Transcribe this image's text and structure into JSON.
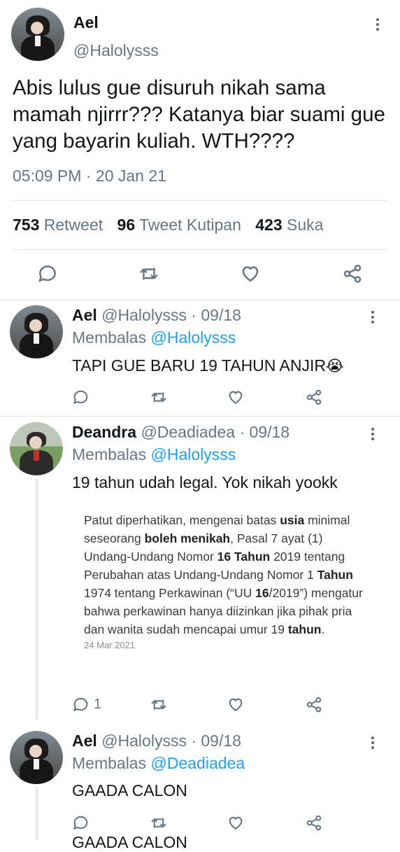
{
  "main_tweet": {
    "name": "Ael",
    "handle": "@Halolysss",
    "text": "Abis lulus gue disuruh nikah sama mamah njirrr??? Katanya biar suami gue yang bayarin kuliah. WTH????",
    "time": "05:09 PM",
    "dot": "·",
    "date": "20 Jan 21",
    "stats": {
      "retweets_count": "753",
      "retweets_label": "Retweet",
      "quotes_count": "96",
      "quotes_label": "Tweet Kutipan",
      "likes_count": "423",
      "likes_label": "Suka"
    }
  },
  "replies": [
    {
      "name": "Ael",
      "handle": "@Halolysss",
      "date": "· 09/18",
      "reply_prefix": "Membalas",
      "reply_to": "@Halolysss",
      "text": "TAPI GUE BARU 19 TAHUN ANJIR",
      "emoji": "😭"
    },
    {
      "name": "Deandra",
      "handle": "@Deadiadea",
      "date": "· 09/18",
      "reply_prefix": "Membalas",
      "reply_to": "@Halolysss",
      "text": "19 tahun udah legal. Yok nikah yookk",
      "quote_date": "24 Mar 2021",
      "reply_count": "1"
    },
    {
      "name": "Ael",
      "handle": "@Halolysss",
      "date": "· 09/18",
      "reply_prefix": "Membalas",
      "reply_to": "@Deadiadea",
      "text": "GAADA CALON"
    }
  ],
  "quote_segments": [
    {
      "t": "Patut diperhatikan, mengenai batas ",
      "b": false
    },
    {
      "t": "usia",
      "b": true
    },
    {
      "t": " minimal seseorang ",
      "b": false
    },
    {
      "t": "boleh menikah",
      "b": true
    },
    {
      "t": ", Pasal 7 ayat (1) Undang-Undang Nomor ",
      "b": false
    },
    {
      "t": "16 Tahun",
      "b": true
    },
    {
      "t": " 2019 tentang Perubahan atas Undang-Undang Nomor 1 ",
      "b": false
    },
    {
      "t": "Tahun",
      "b": true
    },
    {
      "t": " 1974 tentang Perkawinan (“UU ",
      "b": false
    },
    {
      "t": "16",
      "b": true
    },
    {
      "t": "/2019”) mengatur bahwa perkawinan hanya diizinkan jika pihak pria dan wanita sudah mencapai umur 19 ",
      "b": false
    },
    {
      "t": "tahun",
      "b": true
    },
    {
      "t": ".",
      "b": false
    }
  ],
  "partial_text": "GAADA CALON",
  "icons": [
    "more-icon",
    "reply-icon",
    "retweet-icon",
    "like-icon",
    "share-icon"
  ],
  "colors": {
    "link": "#1da1f2",
    "muted": "#657786",
    "divider": "#e1e8ed"
  }
}
